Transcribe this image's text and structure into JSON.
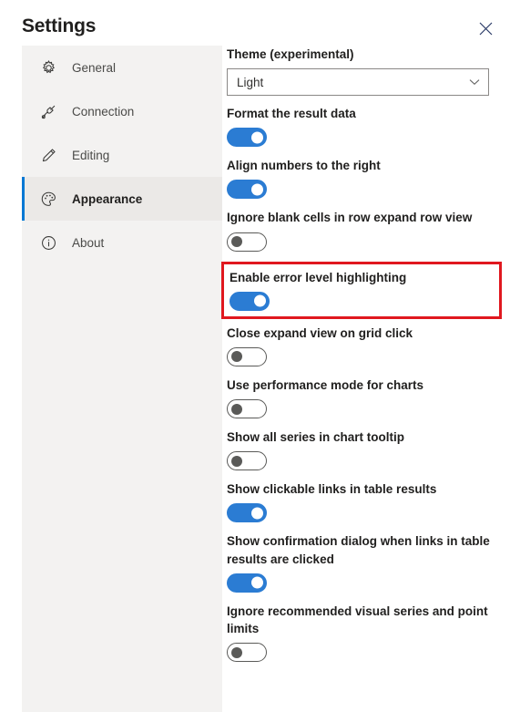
{
  "header": {
    "title": "Settings",
    "close_icon": "close-icon"
  },
  "sidebar": {
    "items": [
      {
        "label": "General",
        "icon": "gear-icon",
        "selected": false
      },
      {
        "label": "Connection",
        "icon": "plug-icon",
        "selected": false
      },
      {
        "label": "Editing",
        "icon": "pencil-icon",
        "selected": false
      },
      {
        "label": "Appearance",
        "icon": "palette-icon",
        "selected": true
      },
      {
        "label": "About",
        "icon": "info-icon",
        "selected": false
      }
    ]
  },
  "content": {
    "theme": {
      "label": "Theme (experimental)",
      "value": "Light",
      "chevron_icon": "chevron-down-icon"
    },
    "settings": [
      {
        "label": "Format the result data",
        "state": "on",
        "highlighted": false
      },
      {
        "label": "Align numbers to the right",
        "state": "on",
        "highlighted": false
      },
      {
        "label": "Ignore blank cells in row expand row view",
        "state": "off",
        "highlighted": false
      },
      {
        "label": "Enable error level highlighting",
        "state": "on",
        "highlighted": true
      },
      {
        "label": "Close expand view on grid click",
        "state": "off",
        "highlighted": false
      },
      {
        "label": "Use performance mode for charts",
        "state": "off",
        "highlighted": false
      },
      {
        "label": "Show all series in chart tooltip",
        "state": "off",
        "highlighted": false
      },
      {
        "label": "Show clickable links in table results",
        "state": "on",
        "highlighted": false
      },
      {
        "label": "Show confirmation dialog when links in table results are clicked",
        "state": "on",
        "highlighted": false
      },
      {
        "label": "Ignore recommended visual series and point limits",
        "state": "off",
        "highlighted": false
      }
    ]
  },
  "colors": {
    "accent": "#0078d4",
    "toggle_on": "#2b7cd3",
    "highlight_border": "#e0181f",
    "sidebar_bg": "#f3f2f1",
    "sidebar_selected_bg": "#ebe9e7"
  }
}
